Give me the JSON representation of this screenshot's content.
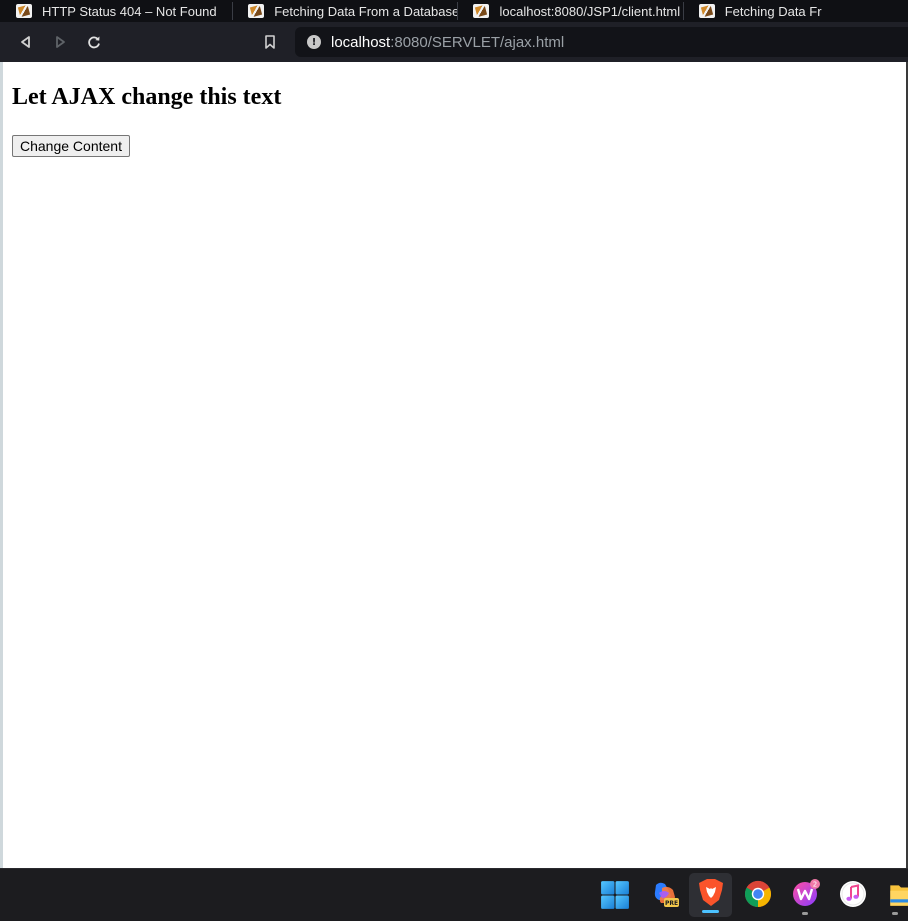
{
  "browser": {
    "tabs": [
      {
        "title": "HTTP Status 404 – Not Found"
      },
      {
        "title": "Fetching Data From a Database"
      },
      {
        "title": "localhost:8080/JSP1/client.html"
      },
      {
        "title": "Fetching Data Fr"
      }
    ],
    "address": {
      "host": "localhost",
      "rest": ":8080/SERVLET/ajax.html"
    }
  },
  "page": {
    "heading": "Let AJAX change this text",
    "button_label": "Change Content"
  },
  "taskbar": {
    "apps": [
      "windows-start",
      "copilot-pre",
      "brave",
      "chrome",
      "wps-office",
      "itunes",
      "file-explorer"
    ],
    "active_app": "brave"
  }
}
